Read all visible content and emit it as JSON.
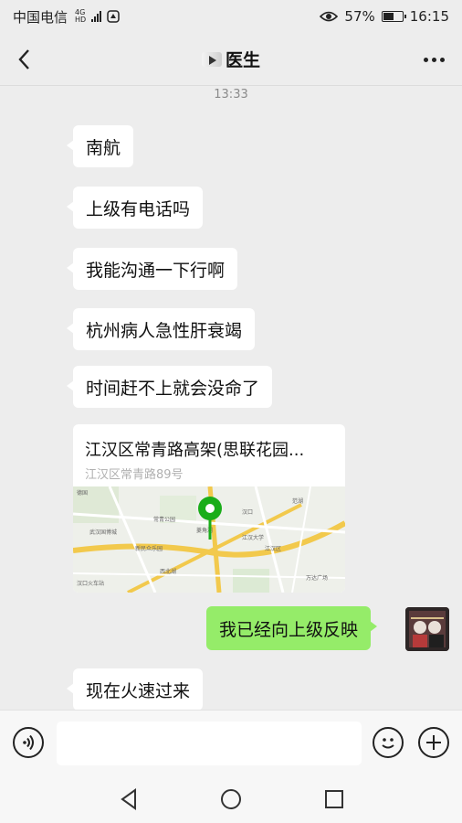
{
  "status_bar": {
    "carrier": "中国电信",
    "network_top": "4G",
    "network_bottom": "HD",
    "battery": "57%",
    "battery_level": 0.57,
    "time": "16:15"
  },
  "header": {
    "title": "医生"
  },
  "chat": {
    "timestamp": "13:33",
    "messages": [
      {
        "side": "left",
        "text": "南航"
      },
      {
        "side": "left",
        "text": "上级有电话吗"
      },
      {
        "side": "left",
        "text": "我能沟通一下行啊"
      },
      {
        "side": "left",
        "text": "杭州病人急性肝衰竭"
      },
      {
        "side": "left",
        "text": "时间赶不上就会没命了"
      },
      {
        "side": "right",
        "text": "我已经向上级反映"
      },
      {
        "side": "left",
        "text": "现在火速过来"
      }
    ],
    "location": {
      "title": "江汉区常青路高架(思联花园...",
      "address": "江汉区常青路89号"
    },
    "map_labels": [
      "德国",
      "常青公园",
      "武汉国博城",
      "新民众乐园",
      "汉口火车站",
      "汉口",
      "江汉区",
      "菱角湖",
      "万达广场",
      "江汉大学",
      "西北湖",
      "范湖"
    ]
  },
  "input_bar": {
    "placeholder": ""
  },
  "colors": {
    "background": "#ededed",
    "sent_bubble": "#95ec69",
    "received_bubble": "#ffffff",
    "map_pin": "#1aad19"
  }
}
